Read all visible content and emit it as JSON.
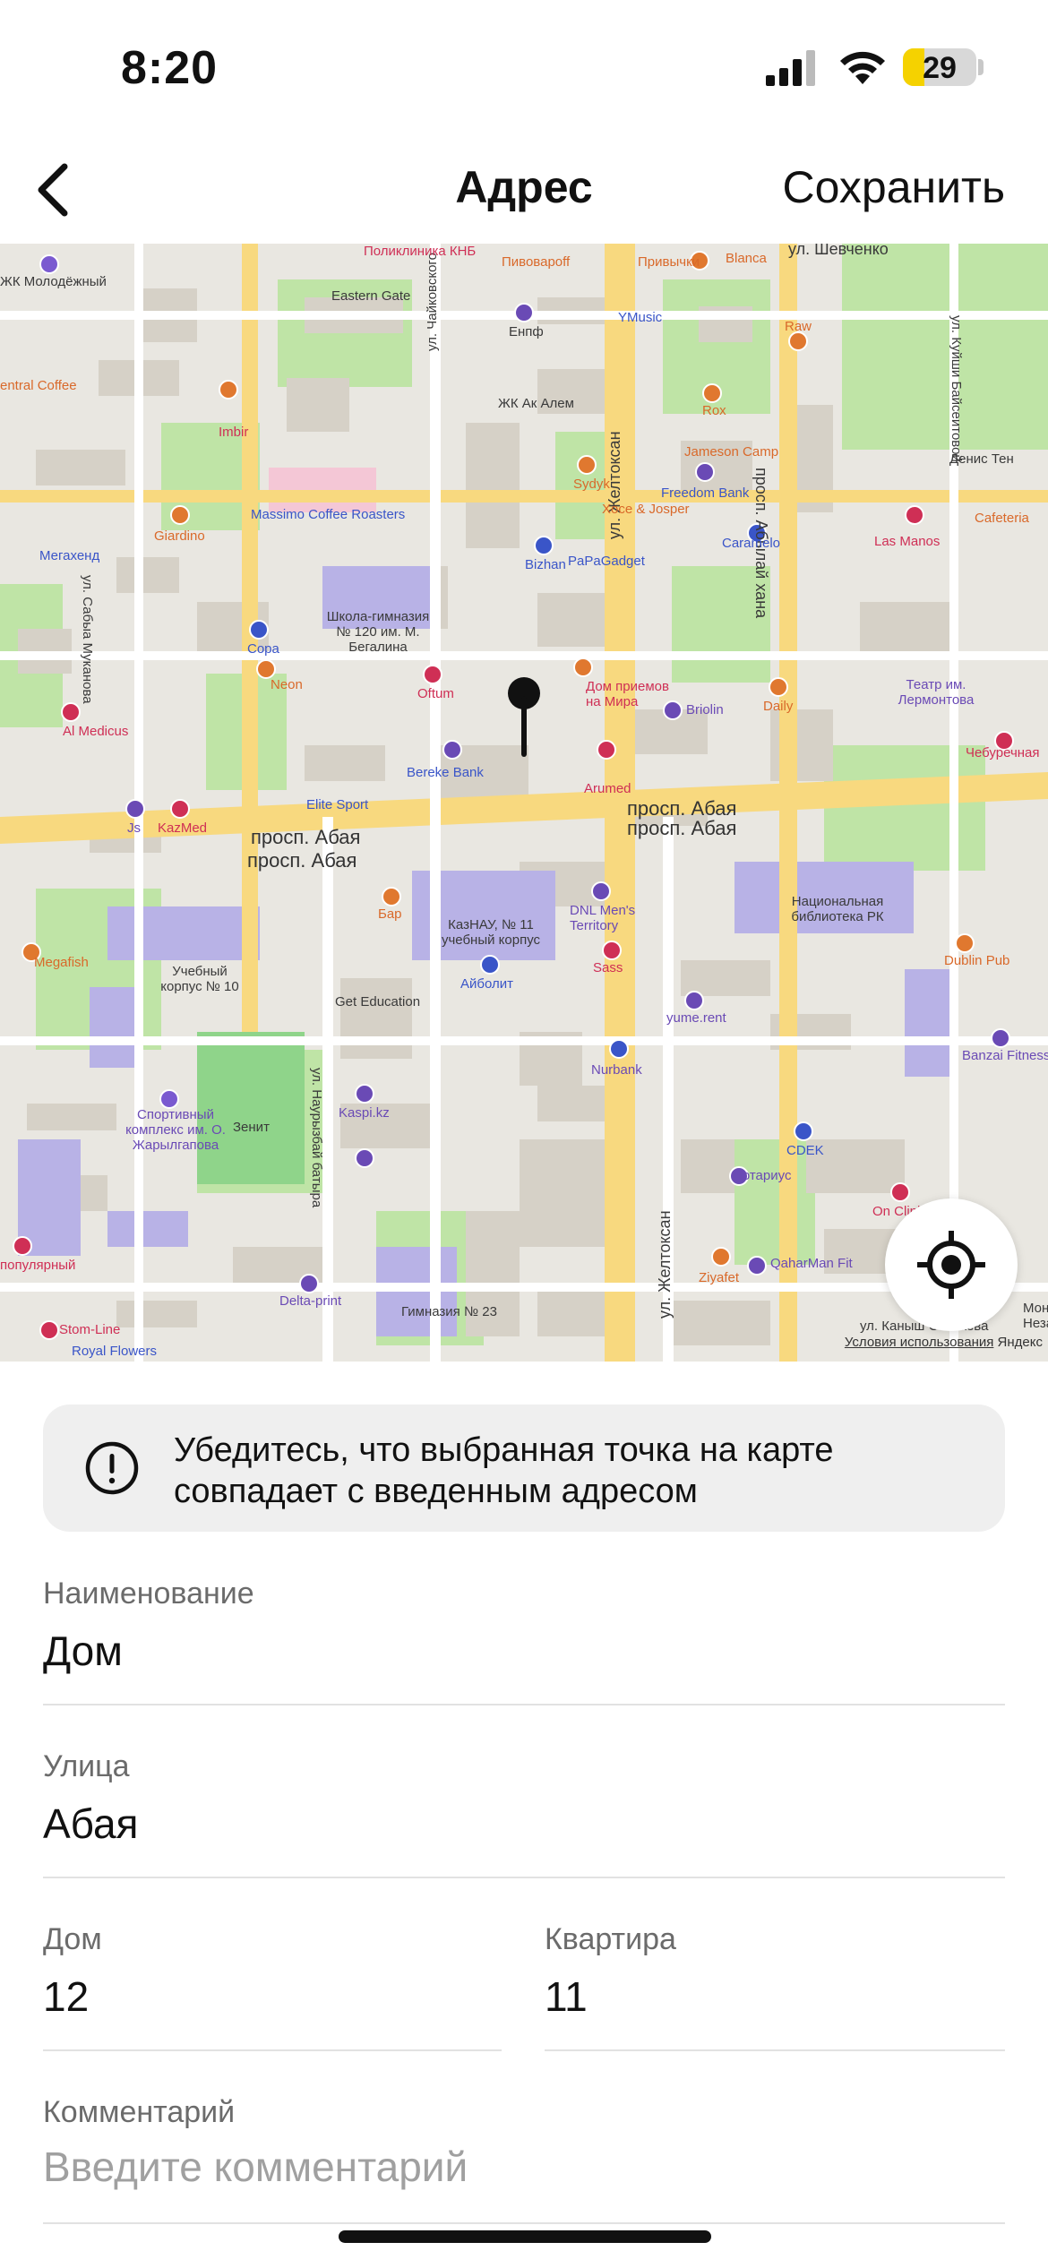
{
  "status_bar": {
    "time": "8:20",
    "battery": "29",
    "battery_level": 0.29
  },
  "navbar": {
    "title": "Адрес",
    "save_label": "Сохранить"
  },
  "map": {
    "labels": {
      "street_shevchenko": "ул. Шевченко",
      "street_chaikovsky": "ул. Чайковского",
      "street_zheltoksan": "ул. Желтоксан",
      "street_zheltoksan2": "ул. Желтоксан",
      "street_ablaikhan": "просп. Абылай хана",
      "street_kuishi": "ул. Куйши Байсеитовой",
      "street_mukanov": "ул. Сабыа Муканова",
      "street_abaya1": "просп. Абая",
      "street_abaya2": "просп. Абая",
      "street_abaya3": "просп. Абая",
      "street_abaya4": "просп. Абая",
      "street_nauryzbai": "ул. Наурызбай батыра",
      "street_kanysh": "ул. Каныш Сатпаева",
      "zhk_molodezhny": "ЖК Молодёжный",
      "poliklinika": "Поликлиника КНБ",
      "pivovaroff": "Пивовароff",
      "privychki": "Привычки",
      "blanca": "Blanca",
      "eastern_gate": "Eastern Gate",
      "enpf": "Енпф",
      "ymusic": "YMusic",
      "raw": "Raw",
      "central_coffee": "entral Coffee",
      "imbir": "Imbir",
      "zhk_ak_alem": "ЖК Ак Алем",
      "rox": "Rox",
      "jameson": "Jameson Camp",
      "denis_ten": "Денис Тен",
      "sydyk": "Sydyk",
      "freedom": "Freedom Bank",
      "xoce": "Xoce & Josper",
      "massimo": "Massimo Coffee Roasters",
      "giardino": "Giardino",
      "cafeteria": "Cafeteria",
      "megahend": "Мегахенд",
      "bizhan": "Bizhan",
      "papagadget": "PaPaGadget",
      "caramelo": "Caramelo",
      "las_manos": "Las Manos",
      "school120": "Школа-гимназия № 120 им. М. Бегалина",
      "dom_priemov": "Дом приемов на Мира",
      "teatr": "Театр им. Лермонтова",
      "copa": "Copa",
      "neon": "Neon",
      "oftum": "Oftum",
      "briolin": "Briolin",
      "daily": "Daily",
      "al_medicus": "Al Medicus",
      "bereke": "Bereke Bank",
      "arumed": "Arumed",
      "cheburechnaya": "Чебуречная",
      "elite_sport": "Elite Sport",
      "kazmed": "KazMed",
      "js": "Js",
      "bar": "Бар",
      "kaznau": "КазНАУ, № 11 учебный корпус",
      "dnl": "DNL Men's Territory",
      "nat_lib": "Национальная библиотека РК",
      "megafish": "Megafish",
      "korpus10": "Учебный корпус № 10",
      "aibolit": "Айболит",
      "sass": "Sass",
      "dublin": "Dublin Pub",
      "get_education": "Get Education",
      "yume": "yume.rent",
      "banzai": "Banzai Fitness",
      "nurbank": "Nurbank",
      "sport_complex": "Спортивный комплекс им. О. Жарылгапова",
      "zenit": "Зенит",
      "kaspi": "Kaspi.kz",
      "cdek": "CDEK",
      "notarius": "Нотариус",
      "on_clinic": "On Clinic",
      "ziyafet": "Ziyafet",
      "qaharman": "QaharMan Fit",
      "populyarny": "популярный",
      "delta_print": "Delta-print",
      "gymn23": "Гимназия № 23",
      "stom_line": "Stom-Line",
      "royal_flowers": "Royal Flowers",
      "mon": "Мон Незав"
    },
    "footer": {
      "terms": "Условия использования",
      "brand": "Яндекс"
    }
  },
  "notice": {
    "text": "Убедитесь, что выбранная точка на карте совпадает с введенным адресом"
  },
  "form": {
    "name": {
      "label": "Наименование",
      "value": "Дом"
    },
    "street": {
      "label": "Улица",
      "value": "Абая"
    },
    "house": {
      "label": "Дом",
      "value": "12"
    },
    "apartment": {
      "label": "Квартира",
      "value": "11"
    },
    "comment": {
      "label": "Комментарий",
      "placeholder": "Введите комментарий"
    }
  },
  "colors": {
    "road": "#f6d27a",
    "park": "#b9e3a2",
    "building": "#d8d4cc",
    "pin": "#111111",
    "accent_yellow": "#f5d200"
  }
}
